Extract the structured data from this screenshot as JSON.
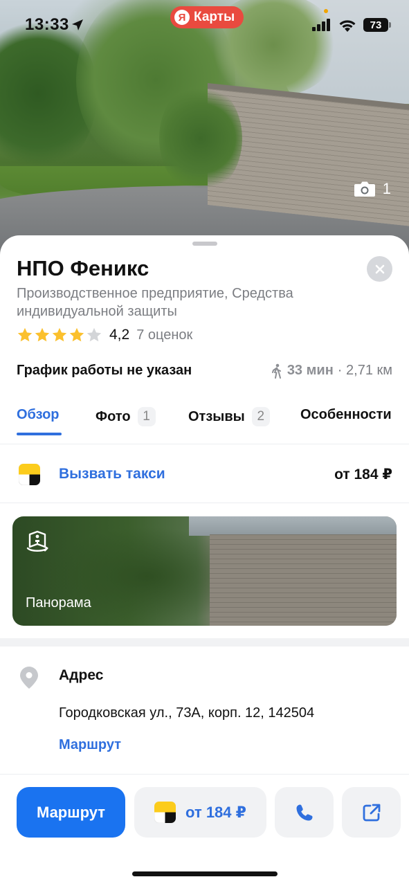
{
  "status_bar": {
    "time": "13:33",
    "app_pill": {
      "logo_letter": "Я",
      "label": "Карты"
    },
    "battery": "73"
  },
  "photo": {
    "count": "1"
  },
  "place": {
    "name": "НПО Феникс",
    "category": "Производственное предприятие, Средства индивидуальной защиты",
    "rating": {
      "value": "4,2",
      "stars_filled": 4,
      "stars_total": 5,
      "reviews": "7 оценок"
    },
    "hours": "График работы не указан",
    "walk": {
      "time": "33 мин",
      "distance": "· 2,71 км"
    }
  },
  "tabs": [
    {
      "label": "Обзор",
      "active": true
    },
    {
      "label": "Фото",
      "badge": "1"
    },
    {
      "label": "Отзывы",
      "badge": "2"
    },
    {
      "label": "Особенности"
    }
  ],
  "taxi": {
    "label": "Вызвать такси",
    "price": "от 184 ₽"
  },
  "panorama": {
    "label": "Панорама"
  },
  "address": {
    "title": "Адрес",
    "value": "Городковская ул., 73А, корп. 12, 142504",
    "route_link": "Маршрут"
  },
  "actions": {
    "route": "Маршрут",
    "taxi_price": "от 184 ₽",
    "call_icon": "phone-icon",
    "share_icon": "share-icon"
  },
  "colors": {
    "accent": "#2f6fde",
    "primary_button": "#1a73f0",
    "star": "#fbc02d",
    "app_pill": "#e94a3f"
  }
}
